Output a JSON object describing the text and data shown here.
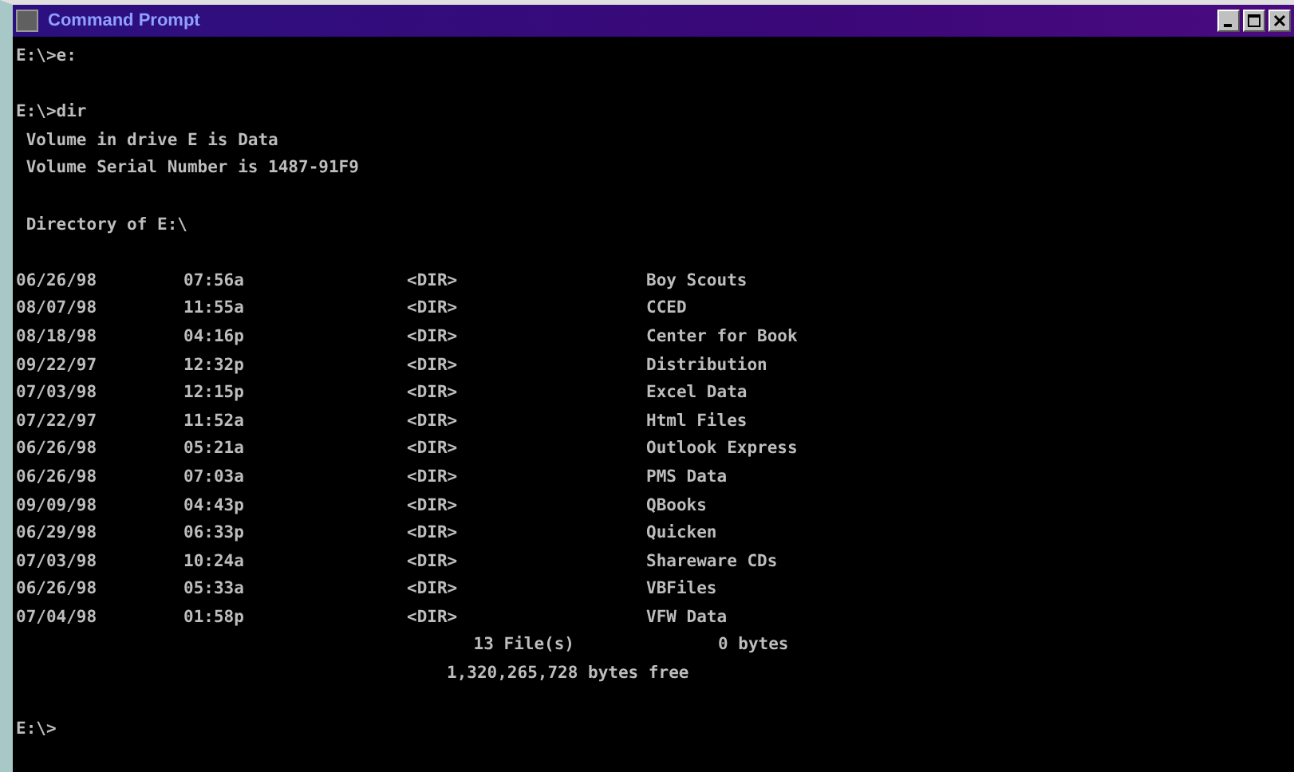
{
  "window": {
    "title": "Command Prompt"
  },
  "console": [
    {
      "kind": "text",
      "text": "E:\\>e:"
    },
    {
      "kind": "blank"
    },
    {
      "kind": "text",
      "text": "E:\\>dir"
    },
    {
      "kind": "text",
      "text": " Volume in drive E is Data"
    },
    {
      "kind": "text",
      "text": " Volume Serial Number is 1487-91F9"
    },
    {
      "kind": "blank"
    },
    {
      "kind": "text",
      "text": " Directory of E:\\"
    },
    {
      "kind": "blank"
    },
    {
      "kind": "entry",
      "date": "06/26/98",
      "time": "07:56a",
      "type": "<DIR>",
      "name": "Boy Scouts"
    },
    {
      "kind": "entry",
      "date": "08/07/98",
      "time": "11:55a",
      "type": "<DIR>",
      "name": "CCED"
    },
    {
      "kind": "entry",
      "date": "08/18/98",
      "time": "04:16p",
      "type": "<DIR>",
      "name": "Center for Book"
    },
    {
      "kind": "entry",
      "date": "09/22/97",
      "time": "12:32p",
      "type": "<DIR>",
      "name": "Distribution"
    },
    {
      "kind": "entry",
      "date": "07/03/98",
      "time": "12:15p",
      "type": "<DIR>",
      "name": "Excel Data"
    },
    {
      "kind": "entry",
      "date": "07/22/97",
      "time": "11:52a",
      "type": "<DIR>",
      "name": "Html Files"
    },
    {
      "kind": "entry",
      "date": "06/26/98",
      "time": "05:21a",
      "type": "<DIR>",
      "name": "Outlook Express"
    },
    {
      "kind": "entry",
      "date": "06/26/98",
      "time": "07:03a",
      "type": "<DIR>",
      "name": "PMS Data"
    },
    {
      "kind": "entry",
      "date": "09/09/98",
      "time": "04:43p",
      "type": "<DIR>",
      "name": "QBooks"
    },
    {
      "kind": "entry",
      "date": "06/29/98",
      "time": "06:33p",
      "type": "<DIR>",
      "name": "Quicken"
    },
    {
      "kind": "entry",
      "date": "07/03/98",
      "time": "10:24a",
      "type": "<DIR>",
      "name": "Shareware CDs"
    },
    {
      "kind": "entry",
      "date": "06/26/98",
      "time": "05:33a",
      "type": "<DIR>",
      "name": "VBFiles"
    },
    {
      "kind": "entry",
      "date": "07/04/98",
      "time": "01:58p",
      "type": "<DIR>",
      "name": "VFW Data"
    },
    {
      "kind": "summary",
      "count": "13 File(s)",
      "size": "0 bytes"
    },
    {
      "kind": "free",
      "text": "1,320,265,728 bytes free"
    },
    {
      "kind": "blank"
    },
    {
      "kind": "text",
      "text": "E:\\>"
    }
  ]
}
